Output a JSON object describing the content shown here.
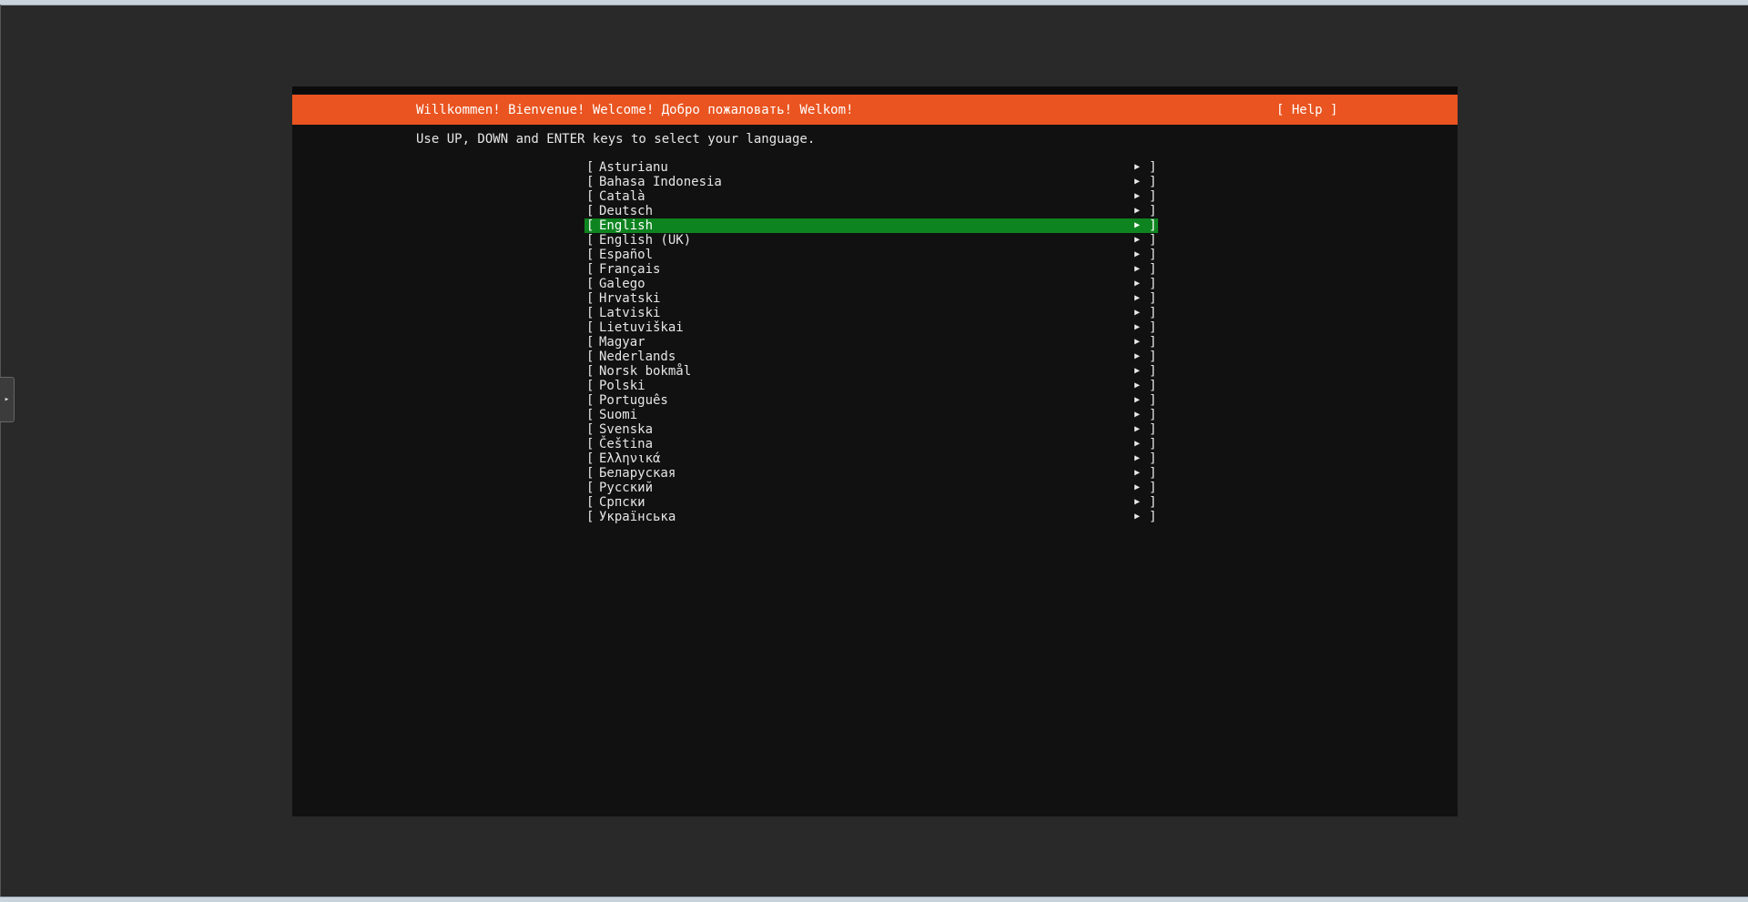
{
  "header": {
    "title": "Willkommen! Bienvenue! Welcome! Добро пожаловать! Welkom!",
    "help_label": "[ Help ]"
  },
  "instructions": "Use UP, DOWN and ENTER keys to select your language.",
  "languages": {
    "selected": "English",
    "bracket_open": "[",
    "bracket_close": "]",
    "arrow": "▶",
    "items": [
      {
        "label": "Asturianu"
      },
      {
        "label": "Bahasa Indonesia"
      },
      {
        "label": "Català"
      },
      {
        "label": "Deutsch"
      },
      {
        "label": "English"
      },
      {
        "label": "English (UK)"
      },
      {
        "label": "Español"
      },
      {
        "label": "Français"
      },
      {
        "label": "Galego"
      },
      {
        "label": "Hrvatski"
      },
      {
        "label": "Latviski"
      },
      {
        "label": "Lietuviškai"
      },
      {
        "label": "Magyar"
      },
      {
        "label": "Nederlands"
      },
      {
        "label": "Norsk bokmål"
      },
      {
        "label": "Polski"
      },
      {
        "label": "Português"
      },
      {
        "label": "Suomi"
      },
      {
        "label": "Svenska"
      },
      {
        "label": "Čeština"
      },
      {
        "label": "Ελληνικά"
      },
      {
        "label": "Беларуская"
      },
      {
        "label": "Русский"
      },
      {
        "label": "Српски"
      },
      {
        "label": "Українська"
      }
    ]
  },
  "side_handle_icon": "▸",
  "colors": {
    "accent": "#e95420",
    "selection": "#0e8420",
    "console_bg": "#111111",
    "page_bg": "#292929"
  }
}
